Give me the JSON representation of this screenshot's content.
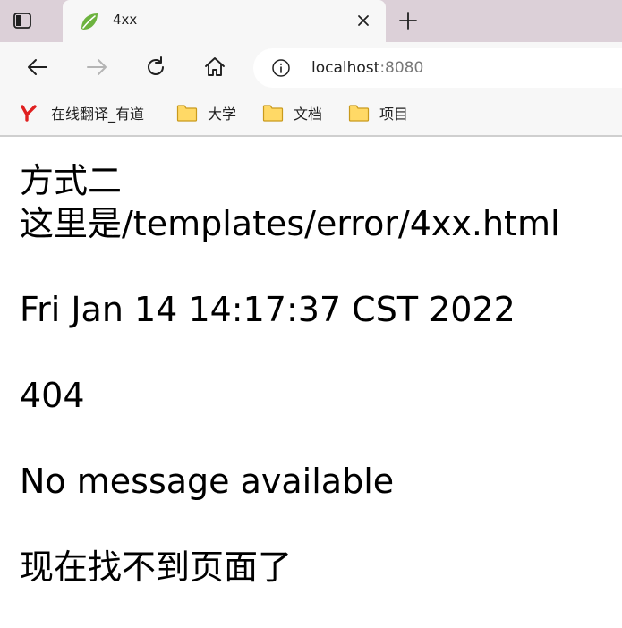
{
  "browser": {
    "tab": {
      "title": "4xx",
      "favicon": "spring-leaf-icon"
    },
    "address": {
      "host": "localhost",
      "port": ":8080"
    },
    "bookmarks": [
      {
        "label": "在线翻译_有道",
        "icon": "youdao-icon"
      },
      {
        "label": "大学",
        "icon": "folder-icon"
      },
      {
        "label": "文档",
        "icon": "folder-icon"
      },
      {
        "label": "项目",
        "icon": "folder-icon"
      }
    ],
    "icons": [
      "tab-actions-icon",
      "close-icon",
      "plus-icon",
      "back-arrow-icon",
      "forward-arrow-icon",
      "reload-icon",
      "home-icon",
      "info-icon"
    ]
  },
  "page": {
    "line1": "方式二",
    "line2": "这里是/templates/error/4xx.html",
    "timestamp": "Fri Jan 14 14:17:37 CST 2022",
    "status": "404",
    "message": "No message available",
    "note": "现在找不到页面了"
  }
}
